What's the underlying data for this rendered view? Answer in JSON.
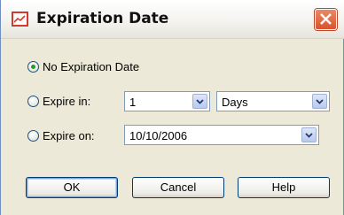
{
  "window": {
    "title": "Expiration Date",
    "icon": "chart-icon"
  },
  "options": {
    "no_expiration": {
      "label": "No Expiration Date",
      "selected": true
    },
    "expire_in": {
      "label": "Expire in:",
      "selected": false,
      "amount": "1",
      "unit": "Days"
    },
    "expire_on": {
      "label": "Expire on:",
      "selected": false,
      "date": "10/10/2006"
    }
  },
  "buttons": {
    "ok": "OK",
    "cancel": "Cancel",
    "help": "Help"
  },
  "colors": {
    "radio_selected": "#21a121",
    "close_button": "#d8532e",
    "border": "#7f9db9"
  }
}
